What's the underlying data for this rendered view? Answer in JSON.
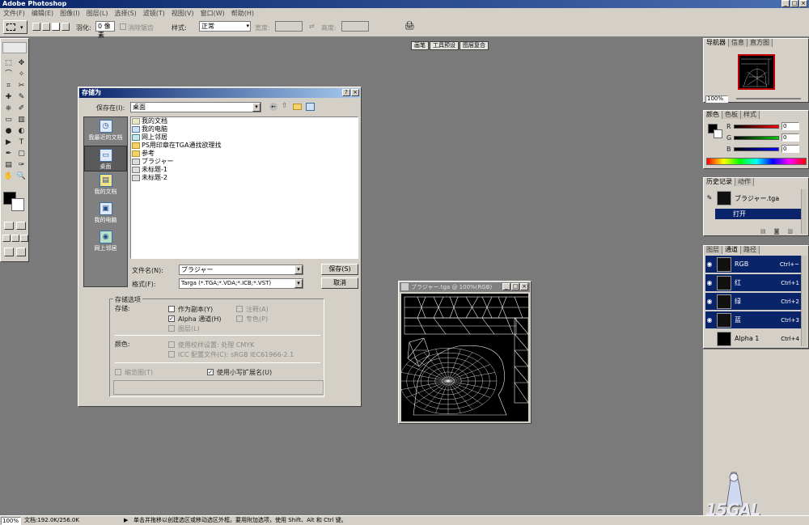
{
  "app": {
    "title": "Adobe Photoshop"
  },
  "menu": [
    "文件(F)",
    "编辑(E)",
    "图像(I)",
    "图层(L)",
    "选择(S)",
    "滤镜(T)",
    "视图(V)",
    "窗口(W)",
    "帮助(H)"
  ],
  "options": {
    "feather_label": "羽化:",
    "feather_value": "0 像素",
    "antialias_label": "消除锯齿",
    "style_label": "样式:",
    "style_value": "正常",
    "width_label": "宽度:",
    "height_label": "高度:"
  },
  "dock_tabs": [
    "画笔",
    "工具预设",
    "图层复合"
  ],
  "dialog": {
    "title": "存储为",
    "save_in_label": "保存在(I):",
    "save_in_value": "桌面",
    "places": [
      {
        "label": "我最近的文档",
        "icon": "recent-docs-icon"
      },
      {
        "label": "桌面",
        "icon": "desktop-icon"
      },
      {
        "label": "我的文档",
        "icon": "my-documents-icon"
      },
      {
        "label": "我的电脑",
        "icon": "my-computer-icon"
      },
      {
        "label": "网上邻居",
        "icon": "network-icon"
      }
    ],
    "files": [
      {
        "name": "我的文档",
        "type": "doc"
      },
      {
        "name": "我的电脑",
        "type": "pc"
      },
      {
        "name": "网上邻居",
        "type": "net"
      },
      {
        "name": "PS用印章在TGA通找欲理找",
        "type": "fold"
      },
      {
        "name": "参考",
        "type": "fold"
      },
      {
        "name": "ブラジャー",
        "type": "img"
      },
      {
        "name": "未标题-1",
        "type": "img"
      },
      {
        "name": "未标题-2",
        "type": "img"
      }
    ],
    "filename_label": "文件名(N):",
    "filename_value": "ブラジャー",
    "format_label": "格式(F):",
    "format_value": "Targa (*.TGA;*.VDA;*.ICB;*.VST)",
    "save_button": "保存(S)",
    "cancel_button": "取消",
    "options_title": "存储选项",
    "store_label": "存储:",
    "as_copy": "作为副本(Y)",
    "alpha": "Alpha 通道(H)",
    "layers": "图层(L)",
    "annotations": "注释(A)",
    "spot": "专色(P)",
    "color_label": "颜色:",
    "proof": "使用校样设置: 处理 CMYK",
    "icc": "ICC 配置文件(C): sRGB IEC61966-2.1",
    "thumbnail": "缩览图(T)",
    "lowercase": "使用小写扩展名(U)"
  },
  "canvas_window": {
    "title": "ブラジャー.tga @ 100%(RGB)"
  },
  "navigator": {
    "tabs": [
      "导航器",
      "信息",
      "直方图"
    ],
    "zoom": "100%"
  },
  "color_panel": {
    "tabs": [
      "颜色",
      "色板",
      "样式"
    ],
    "channels": [
      {
        "label": "R",
        "value": "0"
      },
      {
        "label": "G",
        "value": "0"
      },
      {
        "label": "B",
        "value": "0"
      }
    ]
  },
  "history": {
    "tabs": [
      "历史记录",
      "动作"
    ],
    "snapshot": "ブラジャー.tga",
    "items": [
      "打开"
    ]
  },
  "channels_panel": {
    "tabs": [
      "图层",
      "通道",
      "路径"
    ],
    "rows": [
      {
        "name": "RGB",
        "shortcut": "Ctrl+~",
        "selected": true
      },
      {
        "name": "红",
        "shortcut": "Ctrl+1",
        "selected": true
      },
      {
        "name": "绿",
        "shortcut": "Ctrl+2",
        "selected": true
      },
      {
        "name": "蓝",
        "shortcut": "Ctrl+3",
        "selected": true
      },
      {
        "name": "Alpha 1",
        "shortcut": "Ctrl+4",
        "selected": false
      }
    ]
  },
  "status": {
    "zoom": "100%",
    "doc": "文档:192.0K/256.0K",
    "hint": "单击并拖移以创建选区或移动选区外框。要用附加选项，使用 Shift、Alt 和 Ctrl 键。"
  },
  "watermark": "15GAL",
  "colors": {
    "selection": "#0a246a",
    "chrome": "#d4d0c8",
    "workspace": "#7a7a7a"
  }
}
